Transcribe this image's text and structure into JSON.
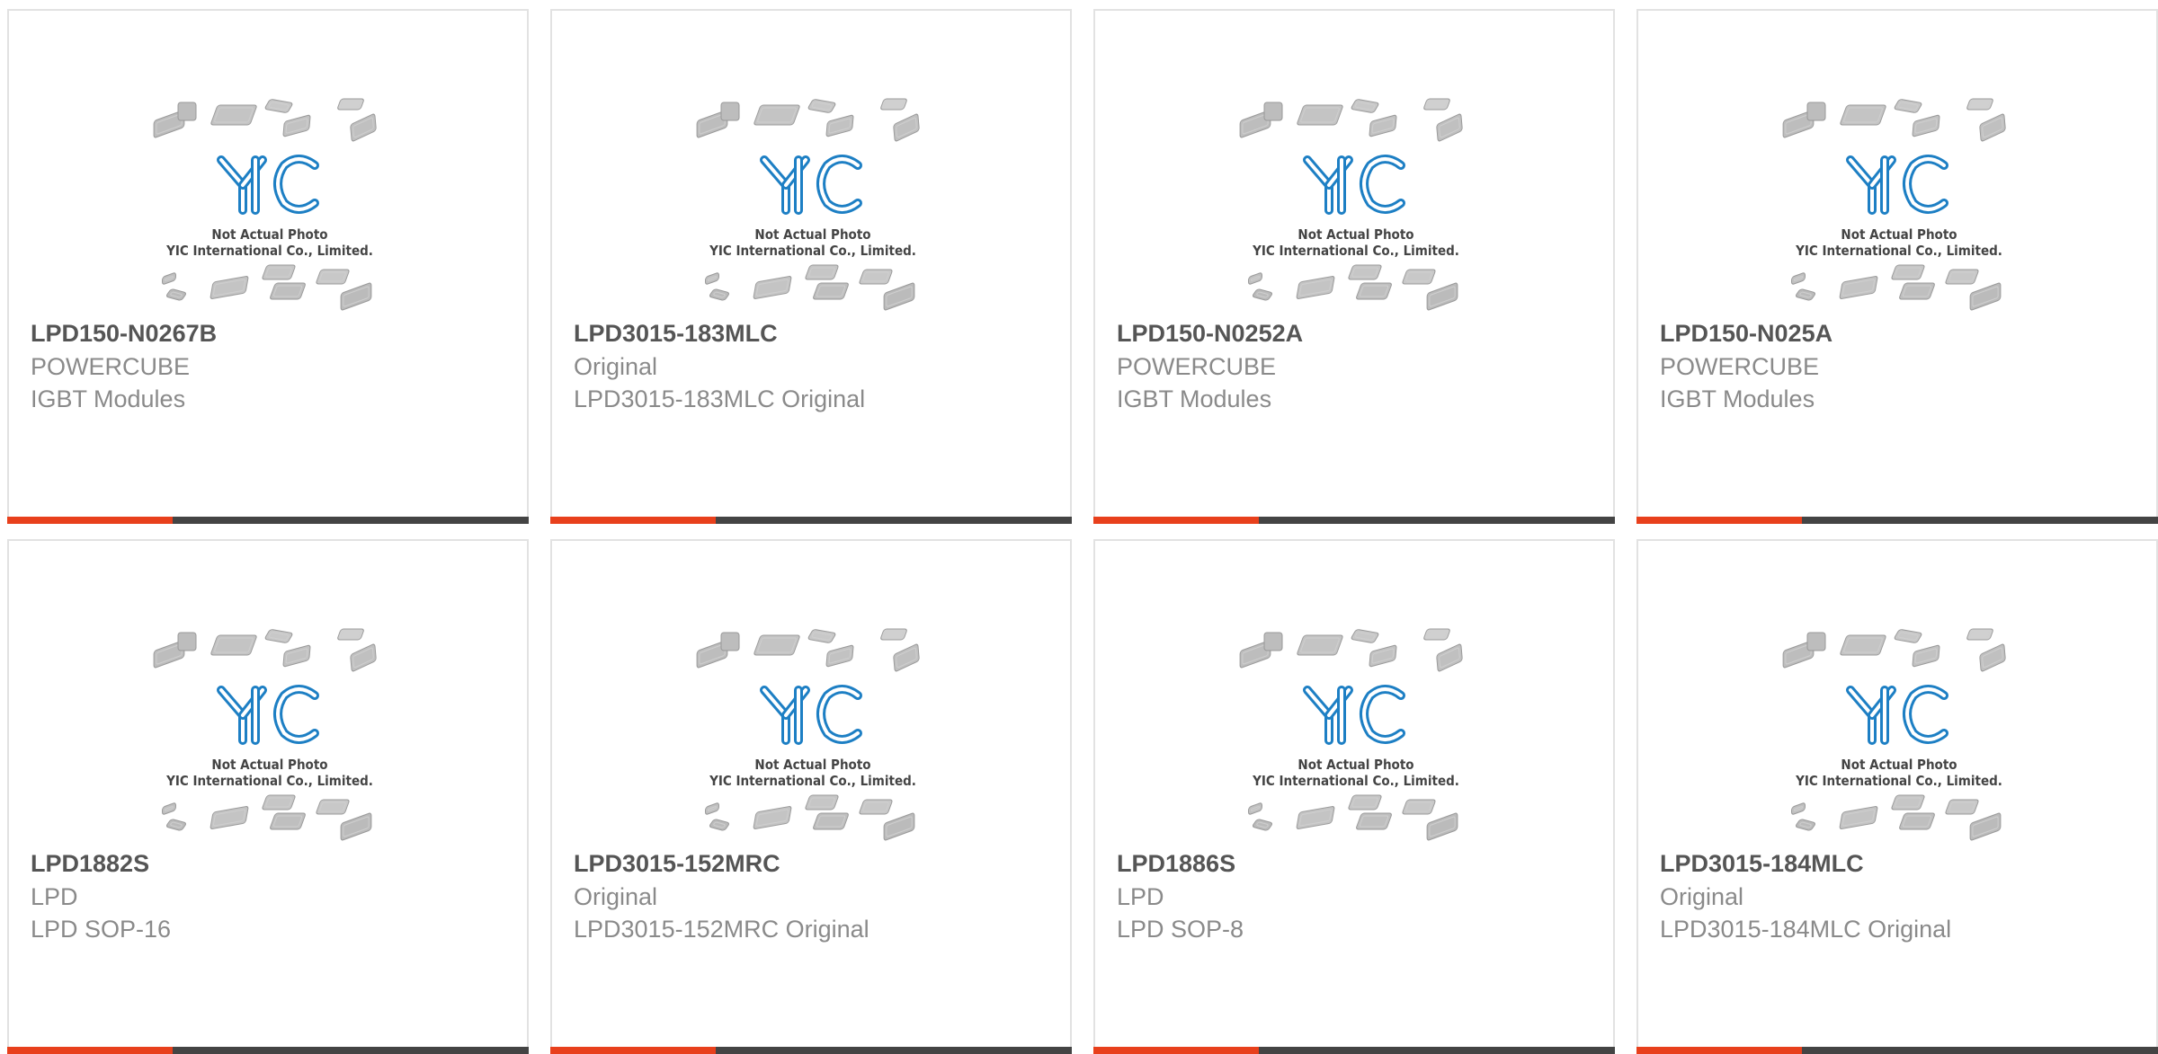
{
  "colors": {
    "accent_bar": "#e8401c",
    "dark_bar": "#444444",
    "logo_blue": "#1d7fc4"
  },
  "placeholder": {
    "line1": "Not Actual Photo",
    "line2": "YIC International Co., Limited.",
    "logo_text": "YIC"
  },
  "products": [
    {
      "part": "LPD150-N0267B",
      "manufacturer": "POWERCUBE",
      "description": "IGBT Modules"
    },
    {
      "part": "LPD3015-183MLC",
      "manufacturer": "Original",
      "description": "LPD3015-183MLC Original"
    },
    {
      "part": "LPD150-N0252A",
      "manufacturer": "POWERCUBE",
      "description": "IGBT Modules"
    },
    {
      "part": "LPD150-N025A",
      "manufacturer": "POWERCUBE",
      "description": "IGBT Modules"
    },
    {
      "part": "LPD1882S",
      "manufacturer": "LPD",
      "description": "LPD SOP-16"
    },
    {
      "part": "LPD3015-152MRC",
      "manufacturer": "Original",
      "description": "LPD3015-152MRC Original"
    },
    {
      "part": "LPD1886S",
      "manufacturer": "LPD",
      "description": "LPD SOP-8"
    },
    {
      "part": "LPD3015-184MLC",
      "manufacturer": "Original",
      "description": "LPD3015-184MLC Original"
    }
  ]
}
